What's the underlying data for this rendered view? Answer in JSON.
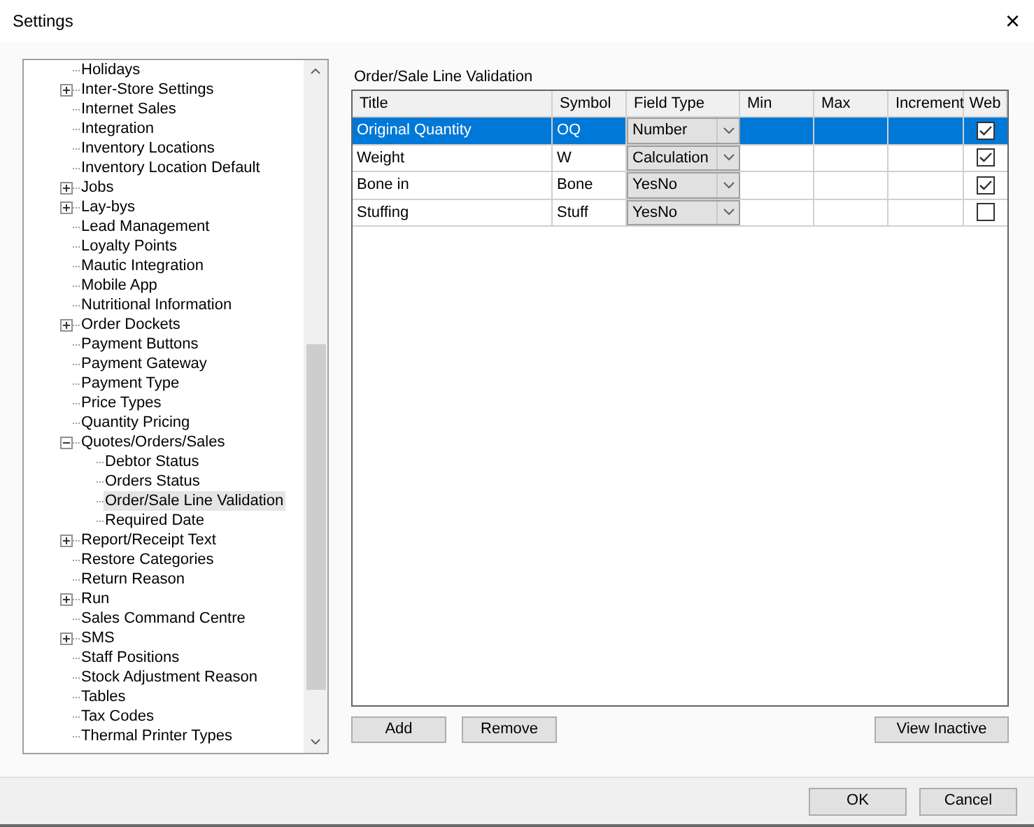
{
  "window": {
    "title": "Settings",
    "close": "×"
  },
  "tree": [
    {
      "label": "Holidays",
      "selected": false
    },
    {
      "label": "Inter-Store Settings",
      "selected": false,
      "expanded": false
    },
    {
      "label": "Internet Sales",
      "selected": false
    },
    {
      "label": "Integration",
      "selected": false
    },
    {
      "label": "Inventory Locations",
      "selected": false
    },
    {
      "label": "Inventory Location Default",
      "selected": false
    },
    {
      "label": "Jobs",
      "selected": false,
      "expanded": false
    },
    {
      "label": "Lay-bys",
      "selected": false,
      "expanded": false
    },
    {
      "label": "Lead Management",
      "selected": false
    },
    {
      "label": "Loyalty Points",
      "selected": false
    },
    {
      "label": "Mautic Integration",
      "selected": false
    },
    {
      "label": "Mobile App",
      "selected": false
    },
    {
      "label": "Nutritional Information",
      "selected": false
    },
    {
      "label": "Order Dockets",
      "selected": false,
      "expanded": false
    },
    {
      "label": "Payment Buttons",
      "selected": false
    },
    {
      "label": "Payment Gateway",
      "selected": false
    },
    {
      "label": "Payment Type",
      "selected": false
    },
    {
      "label": "Price Types",
      "selected": false
    },
    {
      "label": "Quantity Pricing",
      "selected": false
    },
    {
      "label": "Quotes/Orders/Sales",
      "selected": false,
      "expanded": true,
      "children": [
        {
          "label": "Debtor Status",
          "selected": false
        },
        {
          "label": "Orders Status",
          "selected": false
        },
        {
          "label": "Order/Sale Line Validation",
          "selected": true
        },
        {
          "label": "Required Date",
          "selected": false
        }
      ]
    },
    {
      "label": "Report/Receipt Text",
      "selected": false,
      "expanded": false
    },
    {
      "label": "Restore Categories",
      "selected": false
    },
    {
      "label": "Return Reason",
      "selected": false
    },
    {
      "label": "Run",
      "selected": false,
      "expanded": false
    },
    {
      "label": "Sales Command Centre",
      "selected": false
    },
    {
      "label": "SMS",
      "selected": false,
      "expanded": false
    },
    {
      "label": "Staff Positions",
      "selected": false
    },
    {
      "label": "Stock Adjustment Reason",
      "selected": false
    },
    {
      "label": "Tables",
      "selected": false
    },
    {
      "label": "Tax Codes",
      "selected": false
    },
    {
      "label": "Thermal Printer Types",
      "selected": false
    }
  ],
  "panel": {
    "title": "Order/Sale Line Validation",
    "table": {
      "columns": [
        "Title",
        "Symbol",
        "Field Type",
        "Min",
        "Max",
        "Increment",
        "Web"
      ],
      "rows": [
        {
          "title": "Original Quantity",
          "symbol": "OQ",
          "field_type": "Number",
          "web": true,
          "selected": true
        },
        {
          "title": "Weight",
          "symbol": "W",
          "field_type": "Calculation",
          "web": true,
          "selected": false
        },
        {
          "title": "Bone in",
          "symbol": "Bone",
          "field_type": "YesNo",
          "web": true,
          "selected": false
        },
        {
          "title": "Stuffing",
          "symbol": "Stuff",
          "field_type": "YesNo",
          "web": false,
          "selected": false
        }
      ]
    },
    "buttons": [
      "Add",
      "Remove"
    ],
    "right_button": "View Inactive"
  },
  "footer_buttons": [
    "OK",
    "Cancel"
  ]
}
